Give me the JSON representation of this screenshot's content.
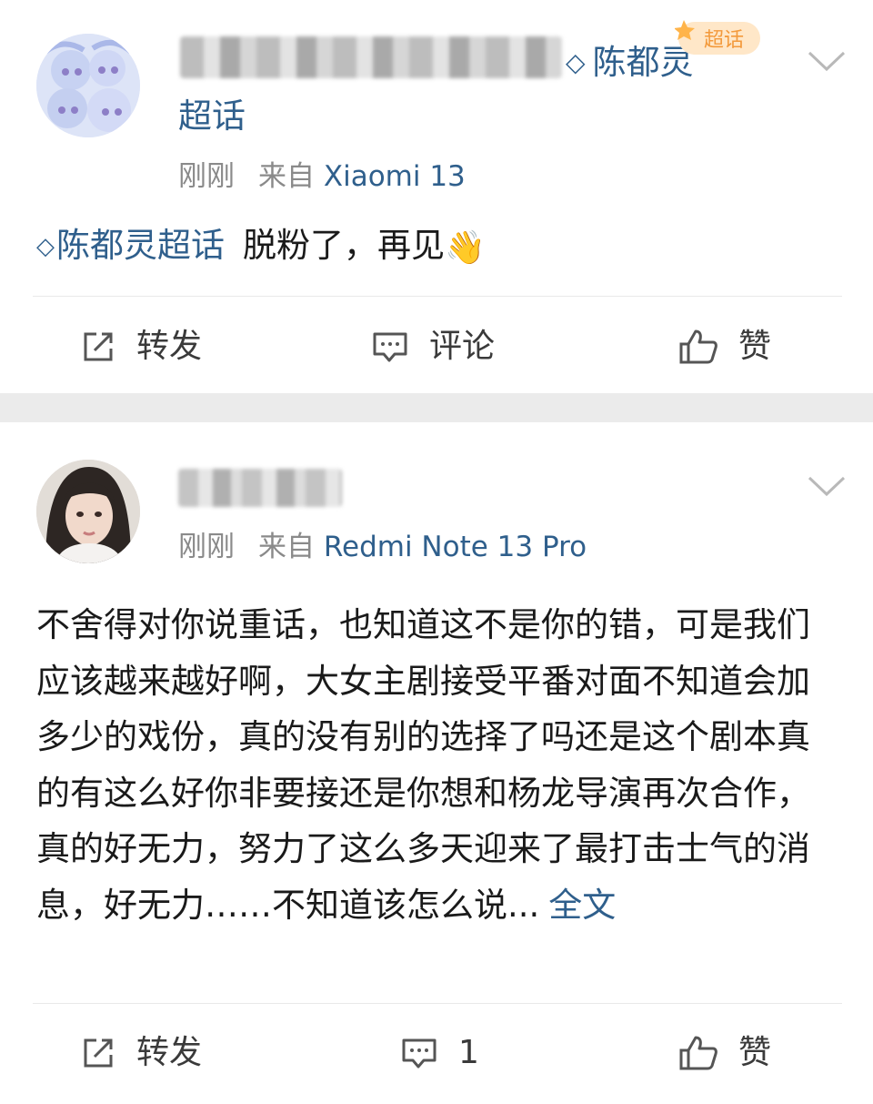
{
  "post1": {
    "topic_name": "陈都灵",
    "topic_badge": "超话",
    "topic_suffix": "超话",
    "meta_time": "刚刚",
    "meta_from": "来自",
    "meta_device": "Xiaomi 13",
    "topic_tag": "陈都灵超话",
    "body": "脱粉了，再见",
    "body_emoji": "👋",
    "actions": {
      "repost": "转发",
      "comment": "评论",
      "like": "赞"
    }
  },
  "post2": {
    "meta_time": "刚刚",
    "meta_from": "来自",
    "meta_device": "Redmi Note 13 Pro",
    "body": "不舍得对你说重话，也知道这不是你的错，可是我们应该越来越好啊，大女主剧接受平番对面不知道会加多少的戏份，真的没有别的选择了吗还是这个剧本真的有这么好你非要接还是你想和杨龙导演再次合作，真的好无力，努力了这么多天迎来了最打击士气的消息，好无力……不知道该怎么说...",
    "more_link": "全文",
    "actions": {
      "repost": "转发",
      "comment_count": "1",
      "like": "赞"
    }
  },
  "colors": {
    "link_blue": "#2f5f8c",
    "meta_grey": "#8a8a8a",
    "separator": "#ebebeb"
  },
  "icons": [
    "avatar-image",
    "chevron-down-icon",
    "diamond-icon",
    "chaohua-badge",
    "repost-icon",
    "comment-icon",
    "like-icon"
  ]
}
